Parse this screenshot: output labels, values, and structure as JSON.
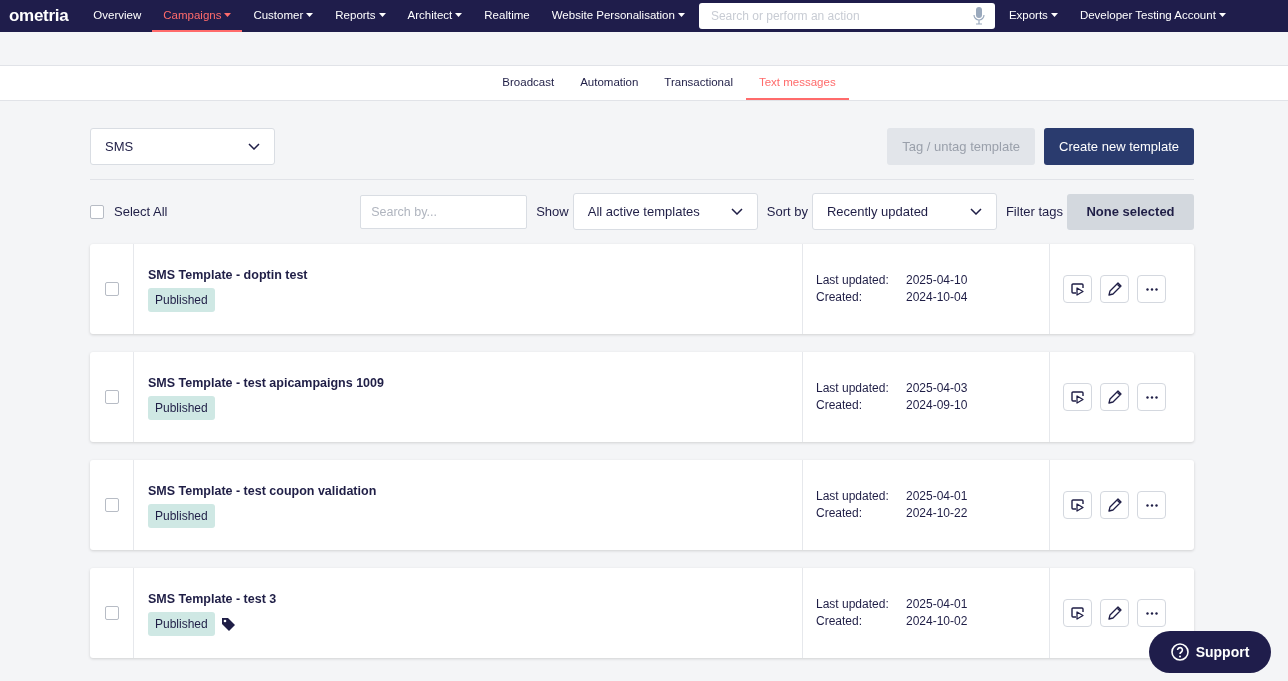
{
  "nav": {
    "logo": "ometria",
    "items": [
      {
        "label": "Overview",
        "dropdown": false,
        "selected": false
      },
      {
        "label": "Campaigns",
        "dropdown": true,
        "selected": true
      },
      {
        "label": "Customer",
        "dropdown": true,
        "selected": false
      },
      {
        "label": "Reports",
        "dropdown": true,
        "selected": false
      },
      {
        "label": "Architect",
        "dropdown": true,
        "selected": false
      },
      {
        "label": "Realtime",
        "dropdown": false,
        "selected": false
      },
      {
        "label": "Website Personalisation",
        "dropdown": true,
        "selected": false
      }
    ],
    "search": {
      "placeholder": "Search or perform an action"
    },
    "right_items": [
      {
        "label": "Exports",
        "dropdown": true
      },
      {
        "label": "Developer Testing Account",
        "dropdown": true
      }
    ]
  },
  "subtabs": [
    {
      "label": "Broadcast",
      "selected": false
    },
    {
      "label": "Automation",
      "selected": false
    },
    {
      "label": "Transactional",
      "selected": false
    },
    {
      "label": "Text messages",
      "selected": true
    }
  ],
  "channel_select": {
    "value": "SMS"
  },
  "buttons": [
    {
      "label": "Tag / untag template",
      "disabled": true
    },
    {
      "label": "Create new template",
      "disabled": false
    }
  ],
  "filters": {
    "select_all": {
      "label": "Select All",
      "checked": false
    },
    "search": {
      "placeholder": "Search by..."
    },
    "show_label": "Show",
    "show_value": "All active templates",
    "sort_label": "Sort by",
    "sort_value": "Recently updated",
    "filter_label": "Filter tags",
    "filter_value": "None selected"
  },
  "templates": [
    {
      "name": "SMS Template - doptin test",
      "status": "Published",
      "tagged": false,
      "checked": false,
      "updated_label": "Last updated:",
      "updated": "2025-04-10",
      "created_label": "Created:",
      "created": "2024-10-04"
    },
    {
      "name": "SMS Template - test apicampaigns 1009",
      "status": "Published",
      "tagged": false,
      "checked": false,
      "updated_label": "Last updated:",
      "updated": "2025-04-03",
      "created_label": "Created:",
      "created": "2024-09-10"
    },
    {
      "name": "SMS Template - test coupon validation",
      "status": "Published",
      "tagged": false,
      "checked": false,
      "updated_label": "Last updated:",
      "updated": "2025-04-01",
      "created_label": "Created:",
      "created": "2024-10-22"
    },
    {
      "name": "SMS Template - test 3",
      "status": "Published",
      "tagged": true,
      "checked": false,
      "updated_label": "Last updated:",
      "updated": "2025-04-01",
      "created_label": "Created:",
      "created": "2024-10-02"
    }
  ],
  "support": {
    "label": "Support"
  }
}
